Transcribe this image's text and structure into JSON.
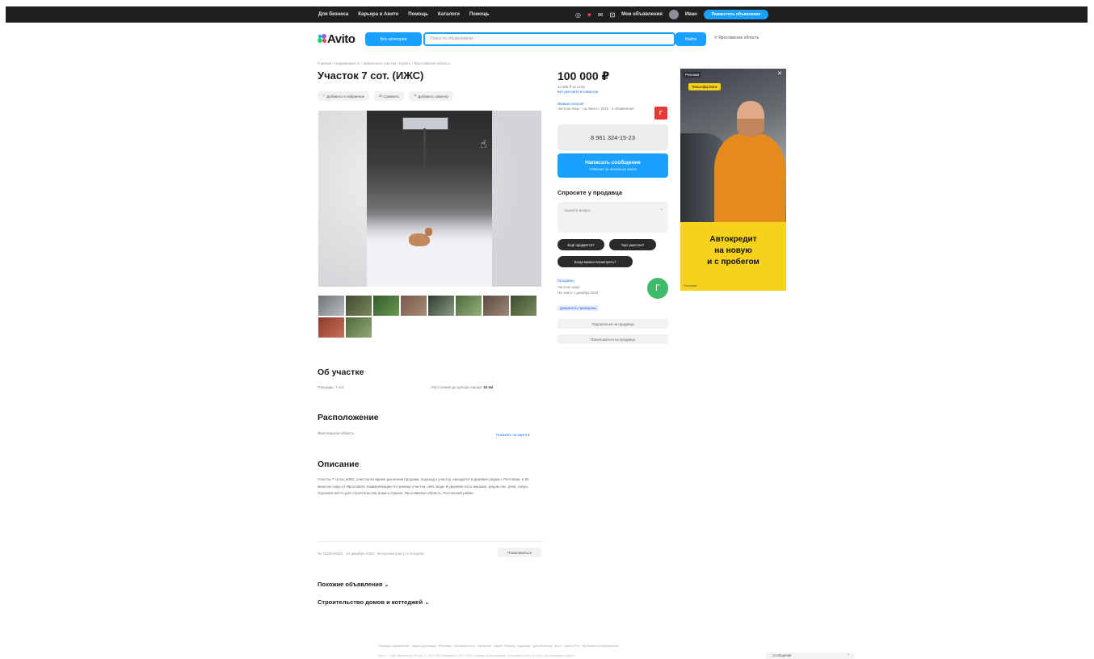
{
  "header": {
    "nav": [
      "Для бизнеса",
      "Карьера в Авито",
      "Помощь",
      "Каталоги",
      "Помощь"
    ],
    "my_ads": "Мои объявления",
    "user": "Иван",
    "post_button": "Разместить объявление"
  },
  "search_bar": {
    "logo": "Avito",
    "all_categories": "Все категории",
    "placeholder": "Поиск по объявлениям",
    "button": "Найти",
    "location": "Ярославская область"
  },
  "listing": {
    "breadcrumbs": "Главная › Недвижимость › Земельные участки › Купить › Ярославская область",
    "title": "Участок 7 сот. (ИЖС)",
    "actions": [
      "Добавить в избранное",
      "Сравнить",
      "Добавить заметку"
    ],
    "photo_count": 10,
    "price": "100 000 ₽",
    "price_note_1": "14 286 ₽ за сотку",
    "price_note_2": "Без депозита и комиссии",
    "seller_name": "Иванов Алексей",
    "seller_note": "Частное лицо · на Авито с 2016 · 2 объявления",
    "seller_badge_letter": "Г",
    "phone": "8 961 324-15-23",
    "message_button": "Написать сообщение",
    "message_sub": "Отвечает за несколько часов",
    "ask_heading": "Спросите у продавца",
    "ask_placeholder": "Задайте вопрос",
    "chips": [
      "Ещё продаётся?",
      "Торг уместен?",
      "Когда можно посмотреть?"
    ],
    "seller_type": "Продавец",
    "seller_info_1": "Частное лицо",
    "seller_info_2": "На Авито с декабря 2016",
    "seller_verified": "Документы проверены",
    "seller_avatar_letter": "Г",
    "subscribe_button": "Подписаться на продавца",
    "report_button": "Пожаловаться на продавца"
  },
  "about": {
    "heading": "Об участке",
    "area_label": "Площадь: 7 сот.",
    "distance_label": "Расстояние до центра города:",
    "distance_value": "15 км"
  },
  "location": {
    "heading": "Расположение",
    "region": "Ярославская область",
    "map_link": "Показать на карте"
  },
  "description": {
    "heading": "Описание",
    "text": "Участок 7 соток, ИЖС, участок во время рыночной продажи, подъезд к участку, находится в деревне рядом с Ростовом, в 40 минутах езды от Ярославля. Коммуникации по границе участка, свет, вода. В деревне есть магазин, рядом лес, река, озеро. Хорошее место для строительства дома и отдыха. Ярославская область, Ростовский район."
  },
  "meta": {
    "info": "№ 3145678912 · 14 декабря 2023 · 56 просмотров (+2 сегодня)",
    "complain": "Пожаловаться"
  },
  "similar": {
    "link1": "Похожие объявления",
    "link2": "Строительство домов и коттеджей"
  },
  "ad": {
    "label": "Реклама",
    "tag": "Тинькофф Банк",
    "line1": "Автокредит",
    "line2": "на новую",
    "line3": "и с пробегом",
    "bottom": "Реклама"
  },
  "footer": {
    "links": "Помощь покупателю · Авито Доставка · Реклама · Безопасность · Каталоги · Авито Работа · Карьера · Для бизнеса · Блог · Авито Pro · Мобильное приложение",
    "legal": "Авито — сайт объявлений России. © ООО «КЕХ еКоммерц» 2007–2023. Условия использования. Оплачивая услуги на сайте, вы принимаете оферту.",
    "chat": "Сообщения"
  },
  "colors": {
    "accent": "#1aa0ff",
    "topbar": "#1f1f1f",
    "ad_yellow": "#f7d21a",
    "alert_red": "#e53935",
    "seller_green": "#3dbb6a"
  },
  "thumbnails": [
    {
      "c1": "#6f7378",
      "c2": "#b9bcc0"
    },
    {
      "c1": "#3f4a32",
      "c2": "#7a8a5a"
    },
    {
      "c1": "#2f5a2a",
      "c2": "#6b9a52"
    },
    {
      "c1": "#7a5a4a",
      "c2": "#a68a78"
    },
    {
      "c1": "#2e3b30",
      "c2": "#8a9c84"
    },
    {
      "c1": "#4a6a3a",
      "c2": "#98b07a"
    },
    {
      "c1": "#5a4a40",
      "c2": "#a08a7a"
    },
    {
      "c1": "#3a4a2e",
      "c2": "#7c8f5e"
    },
    {
      "c1": "#8a3a2a",
      "c2": "#c9705a"
    },
    {
      "c1": "#4f6a3a",
      "c2": "#93a877"
    }
  ]
}
